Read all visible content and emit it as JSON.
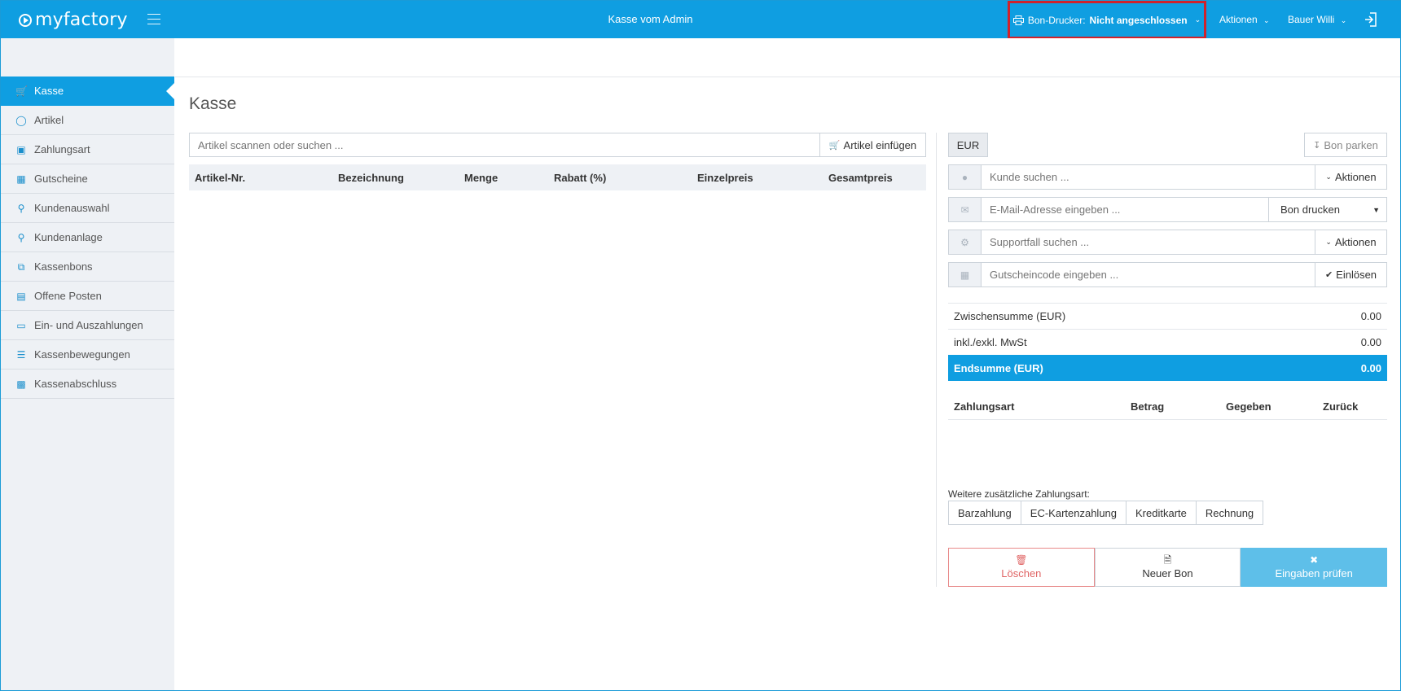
{
  "app": {
    "logo_text": "myfactory",
    "window_title": "Kasse vom Admin"
  },
  "topbar": {
    "printer_label": "Bon-Drucker:",
    "printer_status": "Nicht angeschlossen",
    "menu_actions": "Aktionen",
    "menu_user": "Bauer Willi"
  },
  "sidebar": {
    "items": [
      {
        "label": "Kasse",
        "icon": "cart-icon"
      },
      {
        "label": "Artikel",
        "icon": "tag-icon"
      },
      {
        "label": "Zahlungsart",
        "icon": "wallet-icon"
      },
      {
        "label": "Gutscheine",
        "icon": "gift-icon"
      },
      {
        "label": "Kundenauswahl",
        "icon": "user-search-icon"
      },
      {
        "label": "Kundenanlage",
        "icon": "user-add-icon"
      },
      {
        "label": "Kassenbons",
        "icon": "receipts-icon"
      },
      {
        "label": "Offene Posten",
        "icon": "book-icon"
      },
      {
        "label": "Ein- und Auszahlungen",
        "icon": "inbox-icon"
      },
      {
        "label": "Kassenbewegungen",
        "icon": "list-icon"
      },
      {
        "label": "Kassenabschluss",
        "icon": "report-icon"
      }
    ]
  },
  "main": {
    "title": "Kasse",
    "scan_placeholder": "Artikel scannen oder suchen ...",
    "scan_button": "Artikel einfügen",
    "columns": [
      "Artikel-Nr.",
      "Bezeichnung",
      "Menge",
      "Rabatt (%)",
      "Einzelpreis",
      "Gesamtpreis"
    ]
  },
  "right": {
    "currency": "EUR",
    "park_button": "Bon parken",
    "customer_placeholder": "Kunde suchen ...",
    "customer_actions": "Aktionen",
    "email_placeholder": "E-Mail-Adresse eingeben ...",
    "print_option": "Bon drucken",
    "support_placeholder": "Supportfall suchen ...",
    "support_actions": "Aktionen",
    "voucher_placeholder": "Gutscheincode eingeben ...",
    "redeem_button": "Einlösen",
    "subtotal_label": "Zwischensumme (EUR)",
    "subtotal_value": "0.00",
    "tax_label": "inkl./exkl. MwSt",
    "tax_value": "0.00",
    "total_label": "Endsumme (EUR)",
    "total_value": "0.00",
    "pay_columns": [
      "Zahlungsart",
      "Betrag",
      "Gegeben",
      "Zurück"
    ],
    "more_payment_label": "Weitere zusätzliche Zahlungsart:",
    "payment_types": [
      "Barzahlung",
      "EC-Kartenzahlung",
      "Kreditkarte",
      "Rechnung"
    ],
    "delete_button": "Löschen",
    "new_receipt_button": "Neuer Bon",
    "check_button": "Eingaben prüfen"
  },
  "colors": {
    "accent": "#0f9ee1",
    "highlight_border": "#d0222c",
    "sidebar_bg": "#eef1f5"
  }
}
